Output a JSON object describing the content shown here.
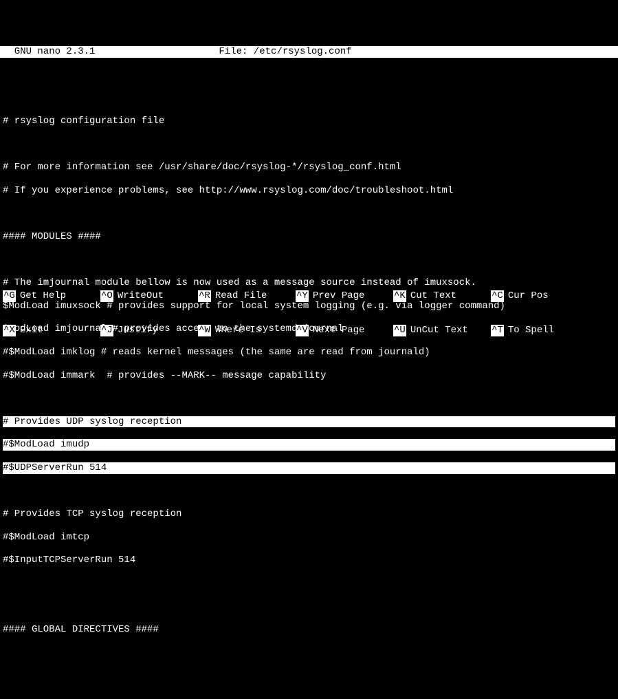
{
  "titlebar": {
    "app": "  GNU nano 2.3.1",
    "file_label": "File: ",
    "filename": "/etc/rsyslog.conf"
  },
  "lines": {
    "l0": "",
    "l1": "# rsyslog configuration file",
    "l2": "",
    "l3": "# For more information see /usr/share/doc/rsyslog-*/rsyslog_conf.html",
    "l4": "# If you experience problems, see http://www.rsyslog.com/doc/troubleshoot.html",
    "l5": "",
    "l6": "#### MODULES ####",
    "l7": "",
    "l8": "# The imjournal module bellow is now used as a message source instead of imuxsock.",
    "l9": "$ModLoad imuxsock # provides support for local system logging (e.g. via logger command)",
    "l10": "$ModLoad imjournal # provides access to the systemd journal",
    "l11": "#$ModLoad imklog # reads kernel messages (the same are read from journald)",
    "l12": "#$ModLoad immark  # provides --MARK-- message capability",
    "l13": "",
    "l14": "# Provides UDP syslog reception",
    "l15": "#$ModLoad imudp",
    "l16": "#$UDPServerRun 514",
    "l17": "",
    "l18": "# Provides TCP syslog reception",
    "l19": "#$ModLoad imtcp",
    "l20": "#$InputTCPServerRun 514",
    "l21": "",
    "l22": "",
    "l23": "#### GLOBAL DIRECTIVES ####"
  },
  "help": {
    "row1": [
      {
        "key": "^G",
        "label": "Get Help"
      },
      {
        "key": "^O",
        "label": "WriteOut"
      },
      {
        "key": "^R",
        "label": "Read File"
      },
      {
        "key": "^Y",
        "label": "Prev Page"
      },
      {
        "key": "^K",
        "label": "Cut Text"
      },
      {
        "key": "^C",
        "label": "Cur Pos"
      }
    ],
    "row2": [
      {
        "key": "^X",
        "label": "Exit"
      },
      {
        "key": "^J",
        "label": "Justify"
      },
      {
        "key": "^W",
        "label": "Where Is"
      },
      {
        "key": "^V",
        "label": "Next Page"
      },
      {
        "key": "^U",
        "label": "UnCut Text"
      },
      {
        "key": "^T",
        "label": "To Spell"
      }
    ]
  }
}
